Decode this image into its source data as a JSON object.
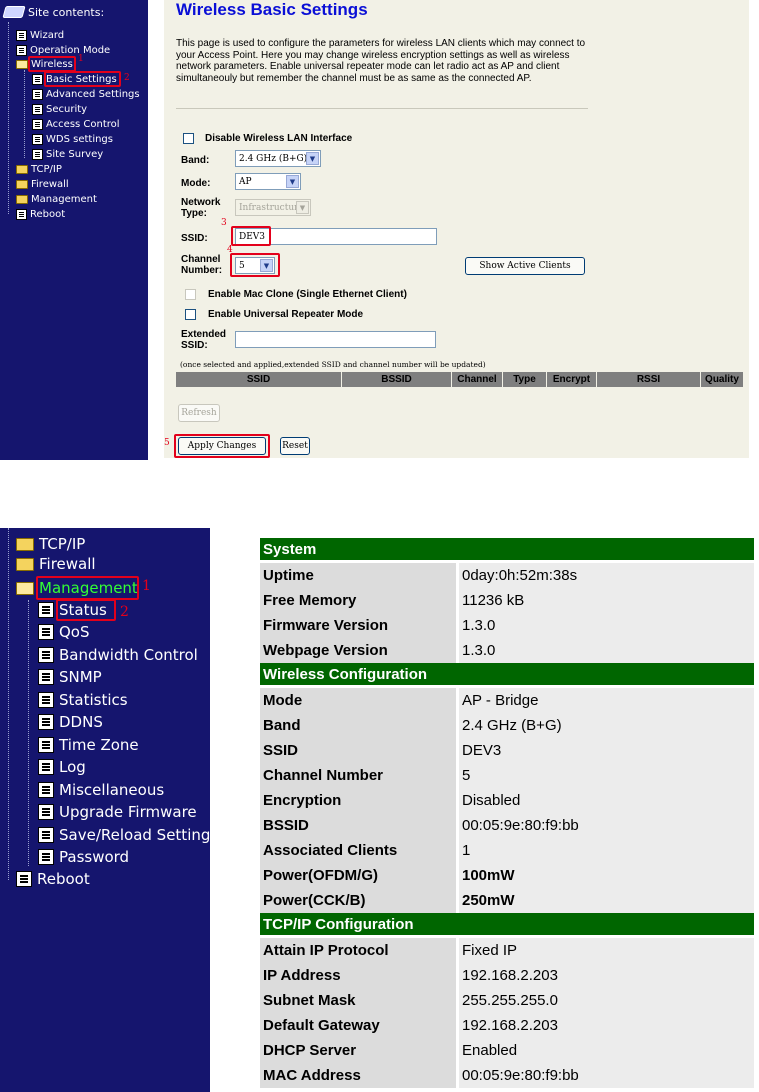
{
  "top": {
    "sidebar": {
      "header": "Site contents:",
      "items": [
        {
          "label": "Wizard"
        },
        {
          "label": "Operation Mode"
        },
        {
          "label": "Wireless"
        },
        {
          "label": "Basic Settings"
        },
        {
          "label": "Advanced Settings"
        },
        {
          "label": "Security"
        },
        {
          "label": "Access Control"
        },
        {
          "label": "WDS settings"
        },
        {
          "label": "Site Survey"
        },
        {
          "label": "TCP/IP"
        },
        {
          "label": "Firewall"
        },
        {
          "label": "Management"
        },
        {
          "label": "Reboot"
        }
      ]
    },
    "annotations": [
      "1",
      "2",
      "3",
      "4",
      "5"
    ],
    "main": {
      "title": "Wireless Basic Settings",
      "description": "This page is used to configure the parameters for wireless LAN clients which may connect to your Access Point. Here you may change wireless encryption settings as well as wireless network parameters. Enable universal repeater mode can let radio act as AP and client simultaneouly but remember the channel must be as same as the connected AP.",
      "disable_wlan_label": "Disable Wireless LAN Interface",
      "band_label": "Band:",
      "band_value": "2.4 GHz (B+G)",
      "mode_label": "Mode:",
      "mode_value": "AP",
      "network_type_label": "Network Type:",
      "network_type_value": "Infrastructure",
      "ssid_label": "SSID:",
      "ssid_value": "DEV3",
      "channel_label": "Channel Number:",
      "channel_value": "5",
      "show_clients_label": "Show Active Clients",
      "mac_clone_label": "Enable Mac Clone (Single Ethernet Client)",
      "repeater_label": "Enable Universal Repeater Mode",
      "extended_ssid_label": "Extended SSID:",
      "extended_ssid_value": "",
      "note": "(once selected and applied,extended SSID and channel number will be updated)",
      "site_columns": [
        "SSID",
        "BSSID",
        "Channel",
        "Type",
        "Encrypt",
        "RSSI",
        "Quality"
      ],
      "refresh_label": "Refresh",
      "apply_label": "Apply Changes",
      "reset_label": "Reset"
    }
  },
  "bottom": {
    "sidebar": {
      "items": [
        {
          "label": "TCP/IP"
        },
        {
          "label": "Firewall"
        },
        {
          "label": "Management"
        },
        {
          "label": "Status"
        },
        {
          "label": "QoS"
        },
        {
          "label": "Bandwidth Control"
        },
        {
          "label": "SNMP"
        },
        {
          "label": "Statistics"
        },
        {
          "label": "DDNS"
        },
        {
          "label": "Time Zone"
        },
        {
          "label": "Log"
        },
        {
          "label": "Miscellaneous"
        },
        {
          "label": "Upgrade Firmware"
        },
        {
          "label": "Save/Reload Setting"
        },
        {
          "label": "Password"
        },
        {
          "label": "Reboot"
        }
      ]
    },
    "status": {
      "sections": [
        {
          "title": "System",
          "rows": [
            {
              "key": "Uptime",
              "value": "0day:0h:52m:38s"
            },
            {
              "key": "Free Memory",
              "value": "11236 kB"
            },
            {
              "key": "Firmware Version",
              "value": "1.3.0"
            },
            {
              "key": "Webpage Version",
              "value": "1.3.0"
            }
          ]
        },
        {
          "title": "Wireless Configuration",
          "rows": [
            {
              "key": "Mode",
              "value": "AP - Bridge"
            },
            {
              "key": "Band",
              "value": "2.4 GHz (B+G)"
            },
            {
              "key": "SSID",
              "value": "DEV3"
            },
            {
              "key": "Channel Number",
              "value": "5"
            },
            {
              "key": "Encryption",
              "value": "Disabled"
            },
            {
              "key": "BSSID",
              "value": "00:05:9e:80:f9:bb"
            },
            {
              "key": "Associated Clients",
              "value": "1"
            },
            {
              "key": "Power(OFDM/G)",
              "value": "100mW"
            },
            {
              "key": "Power(CCK/B)",
              "value": "250mW"
            }
          ]
        },
        {
          "title": "TCP/IP Configuration",
          "rows": [
            {
              "key": "Attain IP Protocol",
              "value": "Fixed IP"
            },
            {
              "key": "IP Address",
              "value": "192.168.2.203"
            },
            {
              "key": "Subnet Mask",
              "value": "255.255.255.0"
            },
            {
              "key": "Default Gateway",
              "value": "192.168.2.203"
            },
            {
              "key": "DHCP Server",
              "value": "Enabled"
            },
            {
              "key": "MAC Address",
              "value": "00:05:9e:80:f9:bb"
            }
          ]
        }
      ]
    }
  }
}
